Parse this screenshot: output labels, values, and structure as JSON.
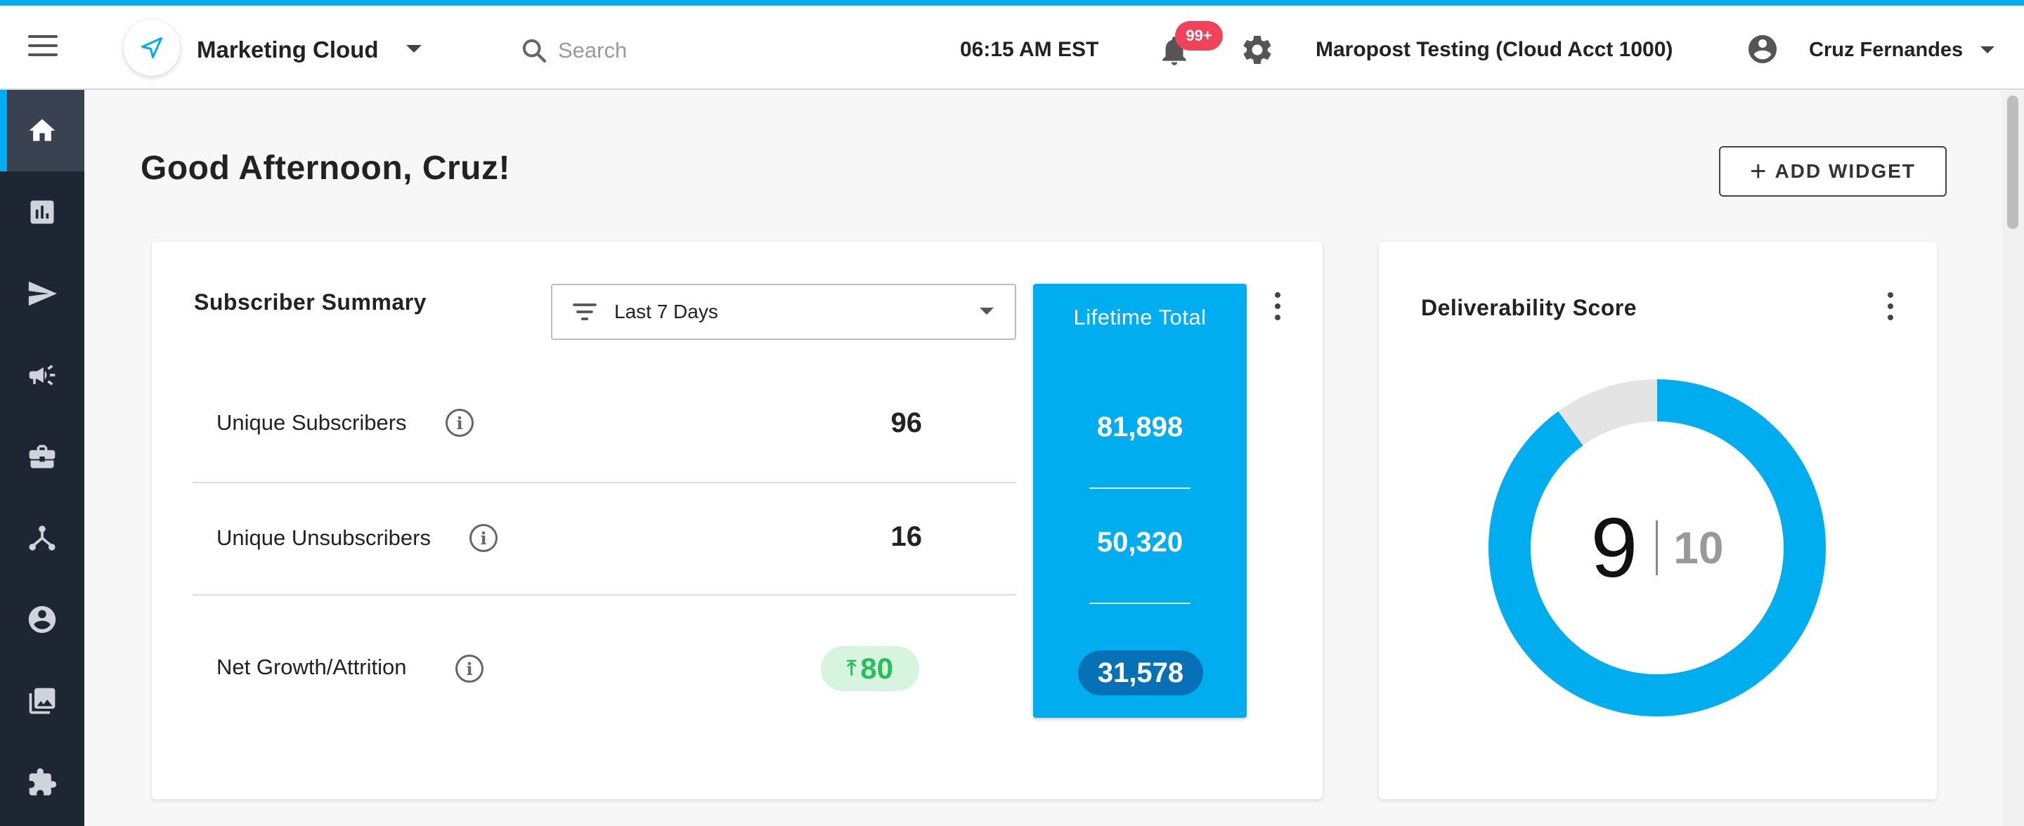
{
  "header": {
    "app_name": "Marketing Cloud",
    "search_placeholder": "Search",
    "time": "06:15 AM EST",
    "notification_badge": "99+",
    "account_name": "Maropost Testing (Cloud Acct 1000)",
    "user_name": "Cruz Fernandes"
  },
  "sidebar": {
    "items": [
      {
        "icon": "home-icon",
        "active": true
      },
      {
        "icon": "reports-icon"
      },
      {
        "icon": "send-icon"
      },
      {
        "icon": "megaphone-icon"
      },
      {
        "icon": "briefcase-icon"
      },
      {
        "icon": "journeys-icon"
      },
      {
        "icon": "contacts-icon"
      },
      {
        "icon": "media-icon"
      },
      {
        "icon": "integrations-icon"
      }
    ]
  },
  "main": {
    "greeting": "Good Afternoon, Cruz!",
    "add_widget_label": "ADD WIDGET"
  },
  "subscriber_summary": {
    "title": "Subscriber Summary",
    "filter_value": "Last 7 Days",
    "rows": [
      {
        "label": "Unique Subscribers",
        "value": "96"
      },
      {
        "label": "Unique Unsubscribers",
        "value": "16"
      },
      {
        "label": "Net Growth/Attrition",
        "value": "80"
      }
    ],
    "lifetime": {
      "title": "Lifetime Total",
      "values": [
        "81,898",
        "50,320",
        "31,578"
      ]
    }
  },
  "deliverability": {
    "title": "Deliverability Score",
    "score": "9",
    "max": "10",
    "score_fraction": 0.9,
    "ring_color": "#00aeef",
    "track_color": "#e4e4e4"
  },
  "colors": {
    "accent": "#00aeef",
    "sidebar": "#1e2533",
    "badge": "#f0435a",
    "growth": "#26c05a"
  }
}
